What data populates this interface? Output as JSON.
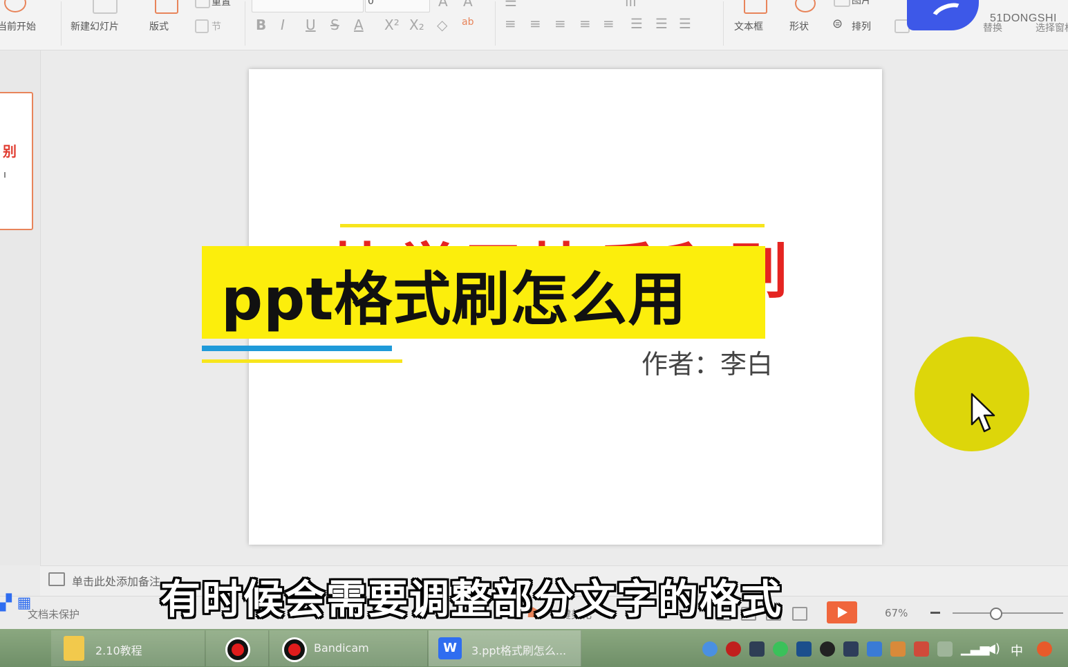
{
  "ribbon": {
    "from_current": "当前开始",
    "new_slide": "新建幻灯片",
    "layout": "版式",
    "section": "节",
    "reset": "重置",
    "font_size": "0",
    "format_glyphs": [
      "B",
      "I",
      "U",
      "S",
      "A",
      "X²",
      "X₂",
      "◇",
      "ab"
    ],
    "textbox": "文本框",
    "shape": "形状",
    "arrange": "排列",
    "picture": "图片",
    "replace": "替换",
    "select": "选择窗格",
    "watermark": "51DONGSHI"
  },
  "thumbnail": {
    "text": "别"
  },
  "slide": {
    "red_title": "快学习快乐和别",
    "overlay_title": "ppt格式刷怎么用",
    "author": "作者：李白"
  },
  "notes": {
    "placeholder": "单击此处添加备注"
  },
  "subtitle": "有时候会需要调整部分文字的格式",
  "statusbar": {
    "protect": "文档未保护",
    "beautify": "一键美化",
    "zoom": "67%"
  },
  "taskbar": {
    "items": [
      {
        "label": "2.10教程",
        "icon": "folder-icon"
      },
      {
        "label": "",
        "icon": "record-icon"
      },
      {
        "label": "Bandicam",
        "icon": "bandicam-icon"
      },
      {
        "label": "3.ppt格式刷怎么...",
        "icon": "wps-presentation-icon"
      }
    ],
    "ime": "中"
  },
  "colors": {
    "title_red": "#e52421",
    "highlight_yellow": "#fcee0c",
    "accent_blue": "#1f9ad9",
    "cursor_halo": "#ddd60a",
    "play_orange": "#f0663c"
  }
}
